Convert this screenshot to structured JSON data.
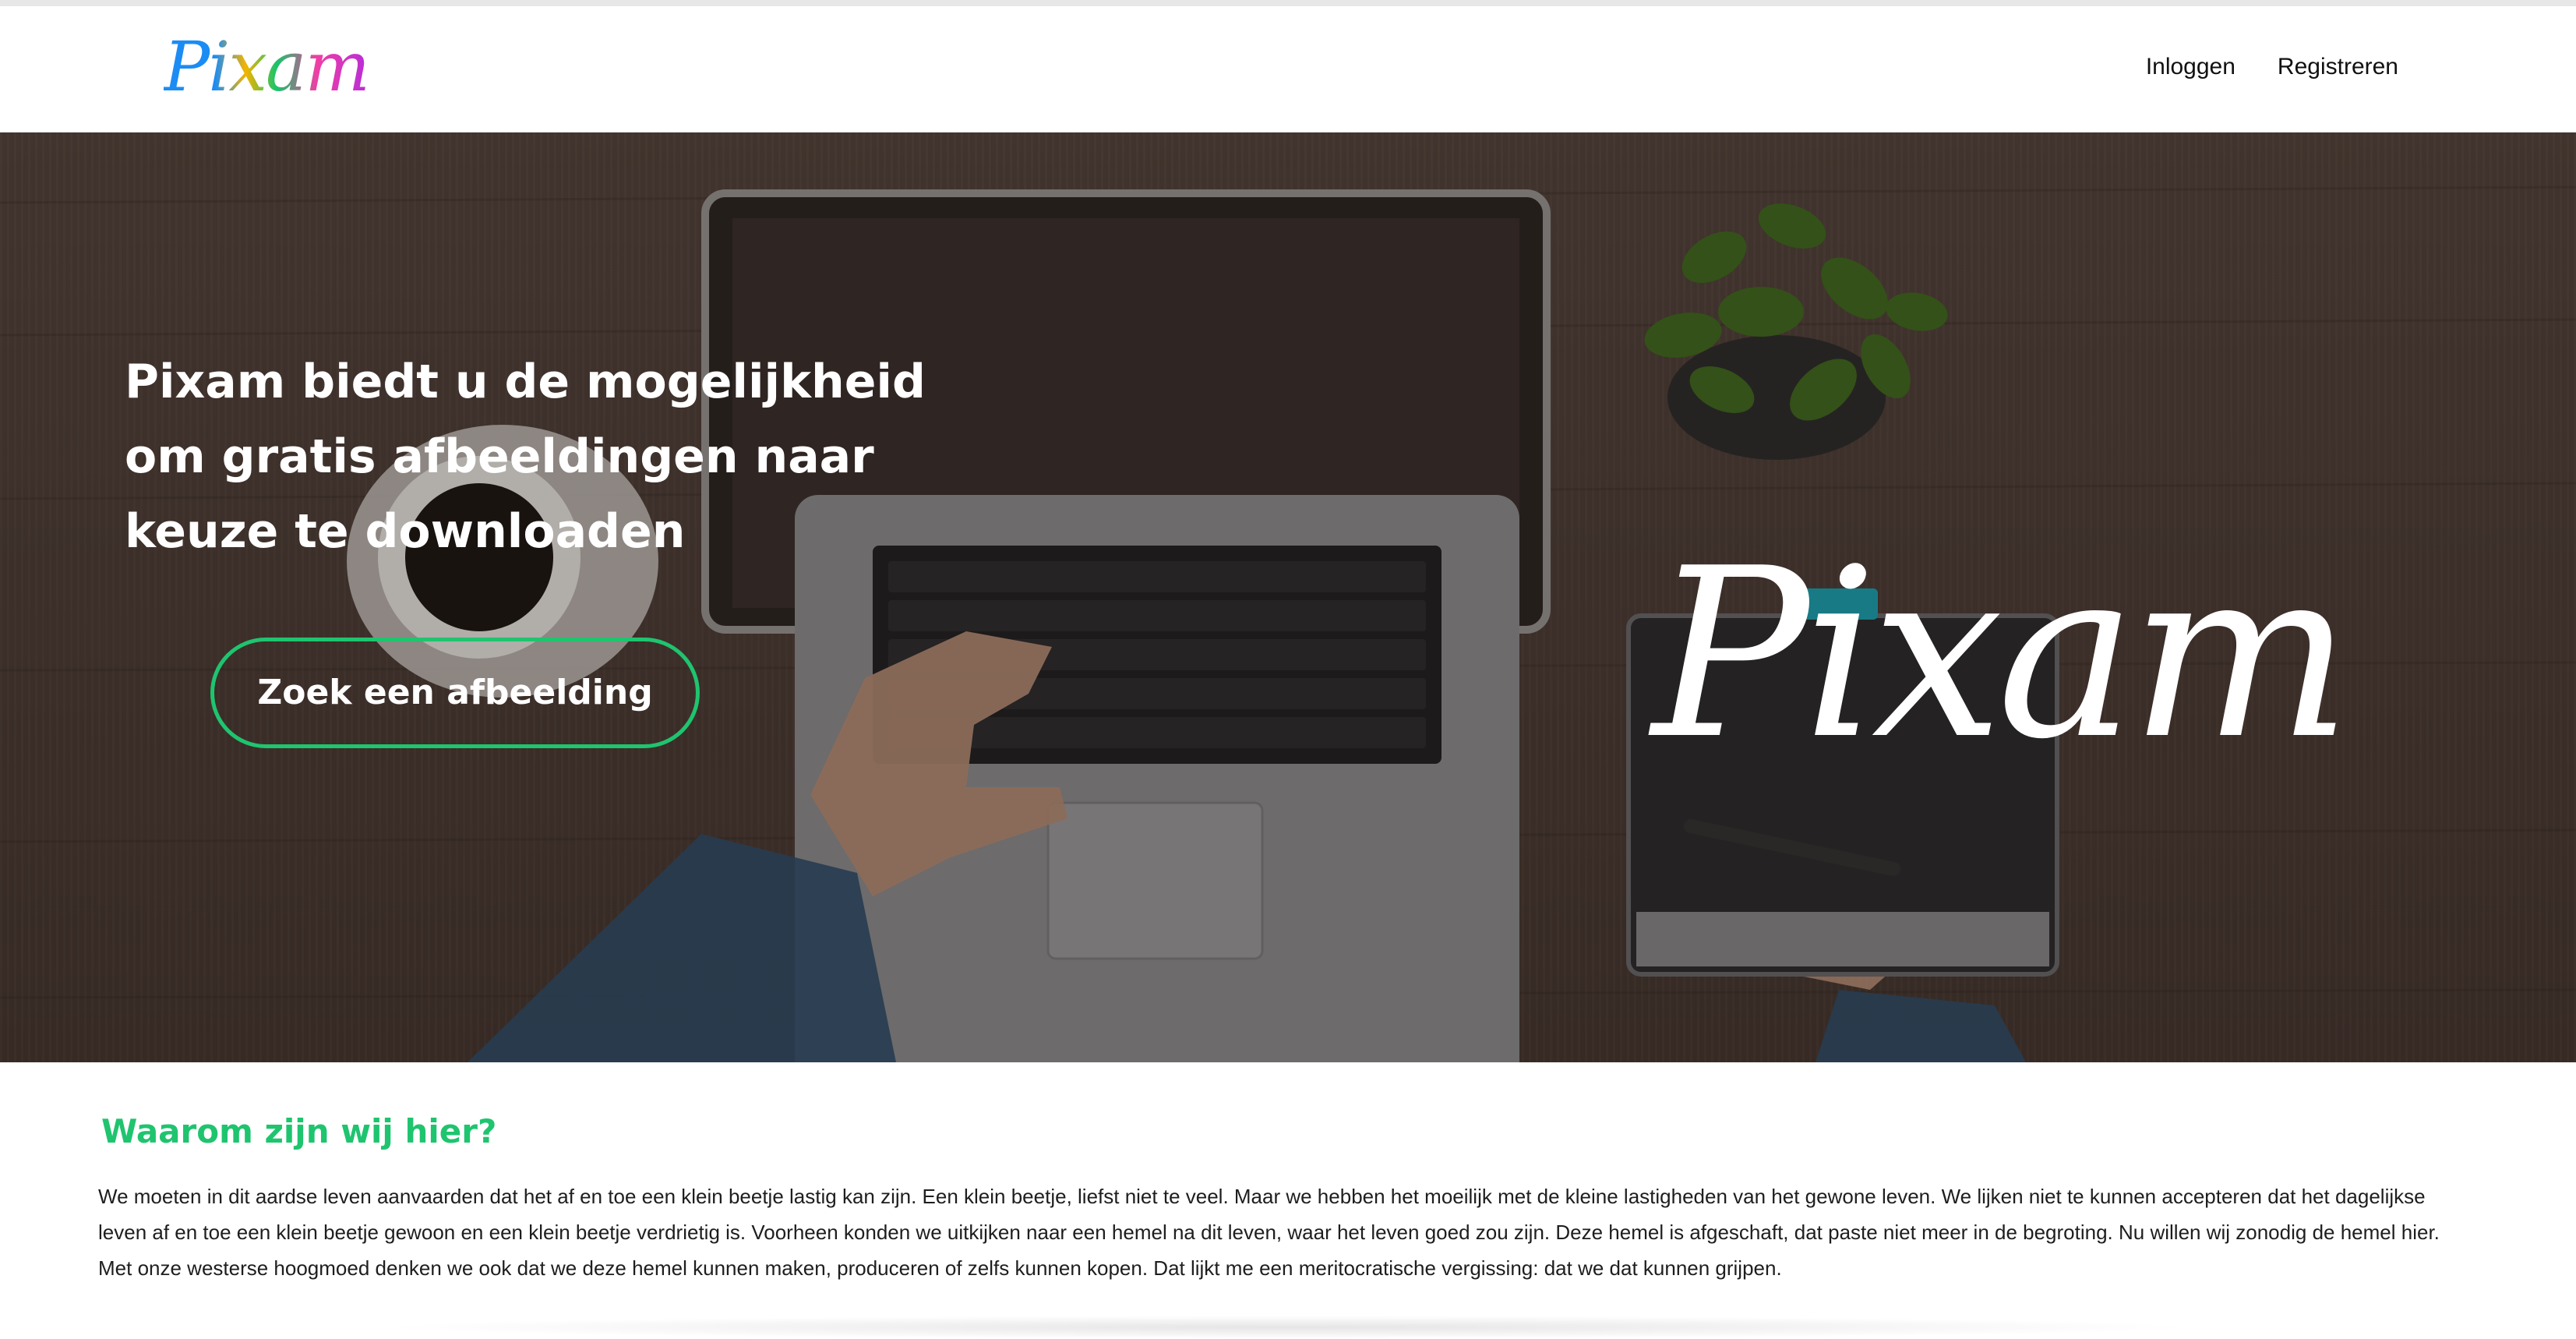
{
  "header": {
    "logo_text": "Pixam",
    "nav": [
      {
        "label": "Inloggen"
      },
      {
        "label": "Registreren"
      }
    ]
  },
  "hero": {
    "title": "Pixam biedt u de mogelijkheid om gratis afbeeldingen naar keuze te downloaden",
    "button_label": "Zoek een afbeelding",
    "wordmark": "Pixam"
  },
  "about": {
    "title": "Waarom zijn wij hier?",
    "text": "We moeten in dit aardse leven aanvaarden dat het af en toe een klein beetje lastig kan zijn. Een klein beetje, liefst niet te veel. Maar we hebben het moeilijk met de kleine lastigheden van het gewone leven. We lijken niet te kunnen accepteren dat het dagelijkse leven af en toe een klein beetje gewoon en een klein beetje verdrietig is. Voorheen konden we uitkijken naar een hemel na dit leven, waar het leven goed zou zijn. Deze hemel is afgeschaft, dat paste niet meer in de begroting. Nu willen wij zonodig de hemel hier. Met onze westerse hoogmoed denken we ook dat we deze hemel kunnen maken, produceren of zelfs kunnen kopen. Dat lijkt me een meritocratische vergissing: dat we dat kunnen grijpen."
  },
  "colors": {
    "accent": "#1fc46f",
    "hero_bg": "#4f3f38"
  }
}
